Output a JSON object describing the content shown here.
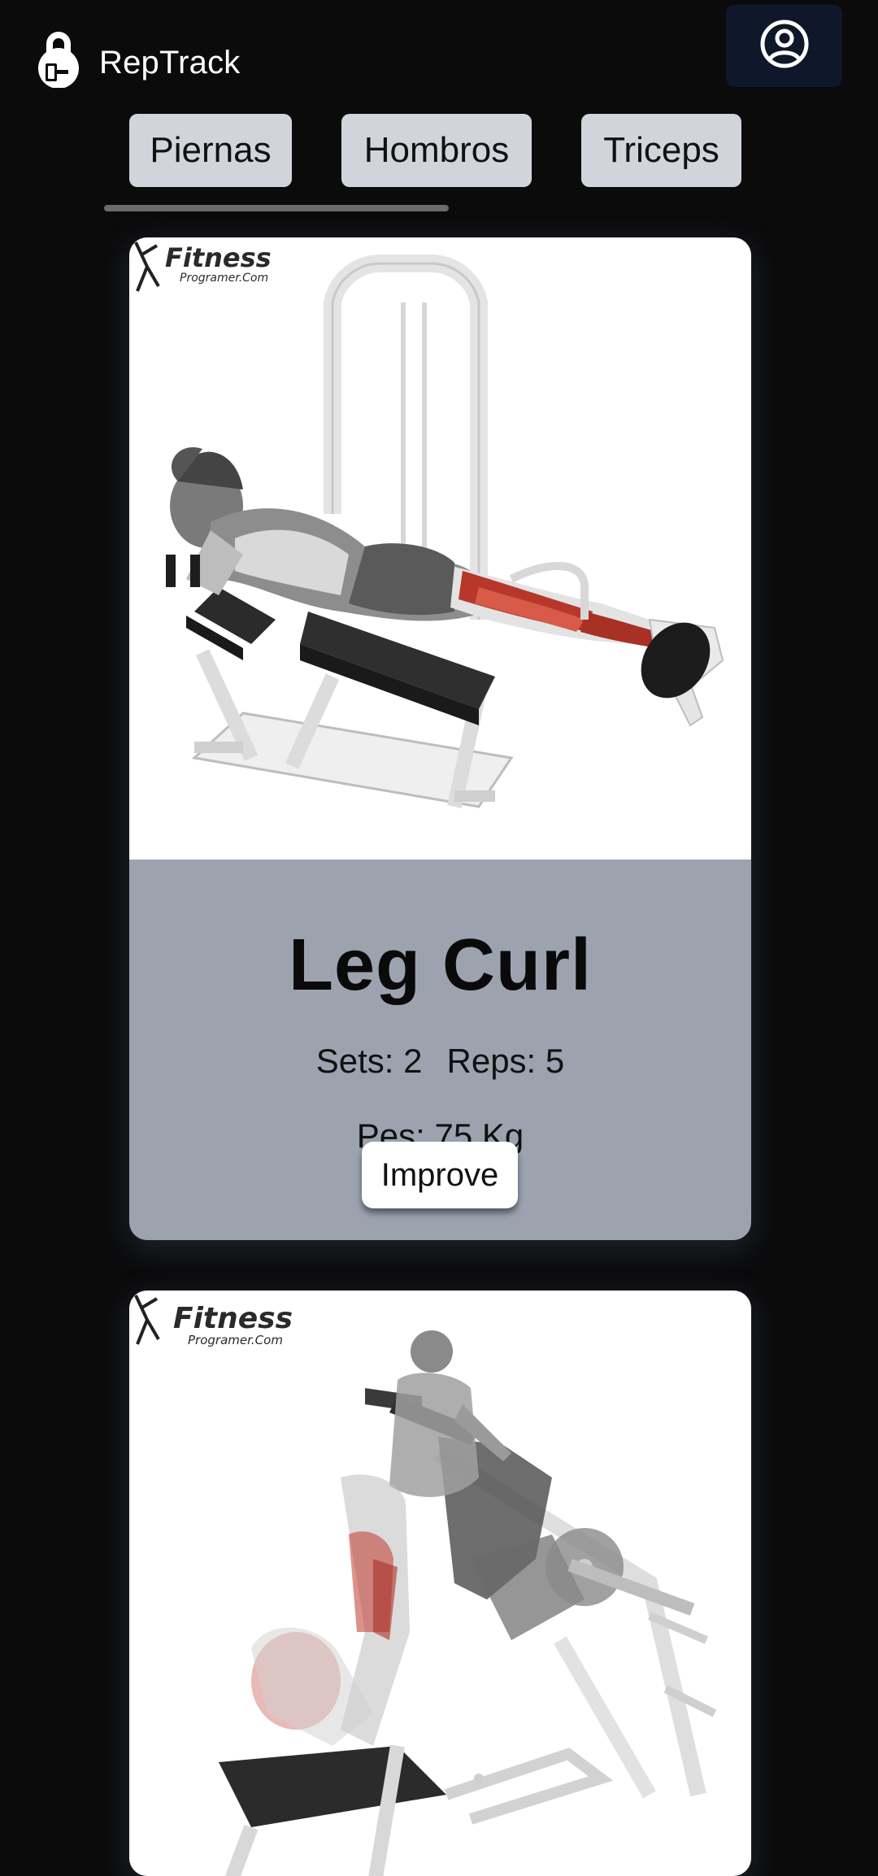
{
  "app": {
    "name": "RepTrack",
    "logo_icon": "kettlebell-icon",
    "profile_icon": "user-circle-icon"
  },
  "tabs": [
    {
      "label": "Piernas"
    },
    {
      "label": "Hombros"
    },
    {
      "label": "Triceps"
    }
  ],
  "exercises": [
    {
      "title": "Leg Curl",
      "sets_label": "Sets: 2",
      "reps_label": "Reps: 5",
      "weight_label": "Pes: 75 Kg",
      "button_label": "Improve",
      "image": {
        "watermark_brand": "Fitness",
        "watermark_sub": "Programer.Com",
        "illustration": "lying-leg-curl-illustration"
      }
    },
    {
      "image": {
        "watermark_brand": "Fitness",
        "watermark_sub": "Programer.Com",
        "illustration": "hack-squat-illustration"
      }
    }
  ],
  "colors": {
    "background": "#0b0b0c",
    "profile_button": "#0f172a",
    "tab_bg": "#d1d5db",
    "card_body": "#9ca3af",
    "muscle_highlight": "#c0392b"
  }
}
